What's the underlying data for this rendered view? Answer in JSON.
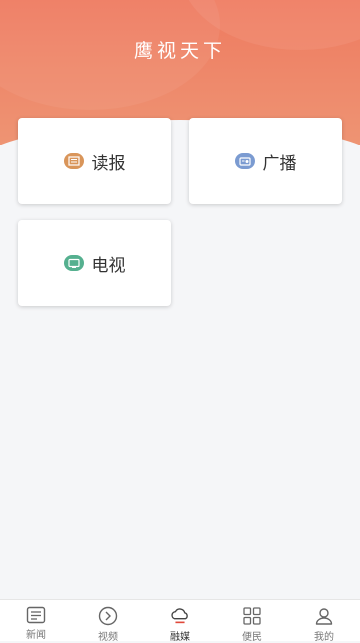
{
  "header": {
    "title": "鹰视天下"
  },
  "cards": [
    {
      "label": "读报",
      "icon": "newspaper-icon",
      "color": "#d9955a"
    },
    {
      "label": "广播",
      "icon": "radio-icon",
      "color": "#7b9bd1"
    },
    {
      "label": "电视",
      "icon": "tv-icon",
      "color": "#55b08f"
    }
  ],
  "tabbar": {
    "items": [
      {
        "label": "新闻",
        "icon": "news-icon"
      },
      {
        "label": "视频",
        "icon": "play-circle-icon"
      },
      {
        "label": "融媒",
        "icon": "cloud-icon",
        "active": true
      },
      {
        "label": "便民",
        "icon": "grid-icon"
      },
      {
        "label": "我的",
        "icon": "user-icon"
      }
    ]
  },
  "colors": {
    "accent": "#ee7a5f",
    "accent_active_underline": "#e0493a"
  }
}
